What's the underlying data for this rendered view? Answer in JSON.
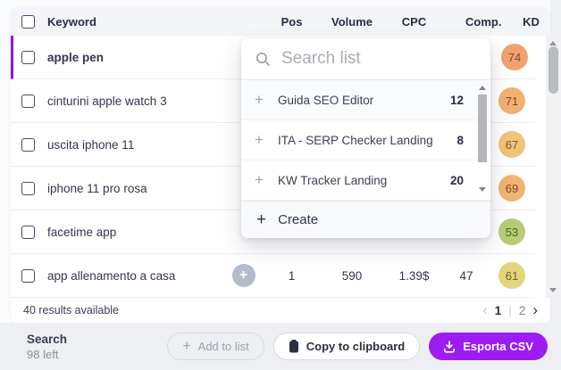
{
  "table": {
    "columns": [
      "Keyword",
      "Pos",
      "Volume",
      "CPC",
      "Comp.",
      "KD"
    ],
    "rows": [
      {
        "keyword": "apple pen",
        "selected": true,
        "bold": true,
        "pos": "",
        "volume": "",
        "cpc": "",
        "comp": "",
        "kd": "74",
        "kd_bg": "#f0a26e",
        "kd_color": "#7c4a26",
        "has_add": false
      },
      {
        "keyword": "cinturini apple watch 3",
        "pos": "",
        "volume": "",
        "cpc": "",
        "comp": "",
        "kd": "71",
        "kd_bg": "#f2b072",
        "kd_color": "#7c4a26",
        "has_add": false
      },
      {
        "keyword": "uscita iphone 11",
        "pos": "",
        "volume": "",
        "cpc": "",
        "comp": "",
        "kd": "67",
        "kd_bg": "#f0c379",
        "kd_color": "#7a5a26",
        "has_add": false
      },
      {
        "keyword": "iphone 11 pro rosa",
        "pos": "",
        "volume": "",
        "cpc": "",
        "comp": "",
        "kd": "69",
        "kd_bg": "#f2b274",
        "kd_color": "#7c4a26",
        "has_add": false
      },
      {
        "keyword": "facetime app",
        "pos": "",
        "volume": "",
        "cpc": "",
        "comp": "",
        "kd": "53",
        "kd_bg": "#b6cd78",
        "kd_color": "#55641f",
        "has_add": false
      },
      {
        "keyword": "app allenamento a casa",
        "pos": "1",
        "volume": "590",
        "cpc": "1.39$",
        "comp": "47",
        "kd": "61",
        "kd_bg": "#e4d57c",
        "kd_color": "#6e6325",
        "has_add": true
      }
    ],
    "footer": {
      "results": "40 results available",
      "pagination": {
        "prev": "‹",
        "pages": [
          "1",
          "2"
        ],
        "separator": "|",
        "next": "›"
      }
    }
  },
  "popover": {
    "search_placeholder": "Search list",
    "items": [
      {
        "label": "Guida SEO Editor",
        "count": "12"
      },
      {
        "label": "ITA - SERP Checker Landing",
        "count": "8"
      },
      {
        "label": "KW Tracker Landing",
        "count": "20"
      }
    ],
    "create_label": "Create"
  },
  "action_bar": {
    "credits_title": "Search",
    "credits_left": "98 left",
    "add_to_list": "Add to list",
    "copy": "Copy to clipboard",
    "export": "Esporta CSV"
  },
  "icons": {
    "plus": "+"
  },
  "colors": {
    "accent_purple": "#9412ea",
    "export_button": "#9d1cf2",
    "header_bg": "#f4f5f9",
    "action_bar_bg": "#edeff2"
  }
}
